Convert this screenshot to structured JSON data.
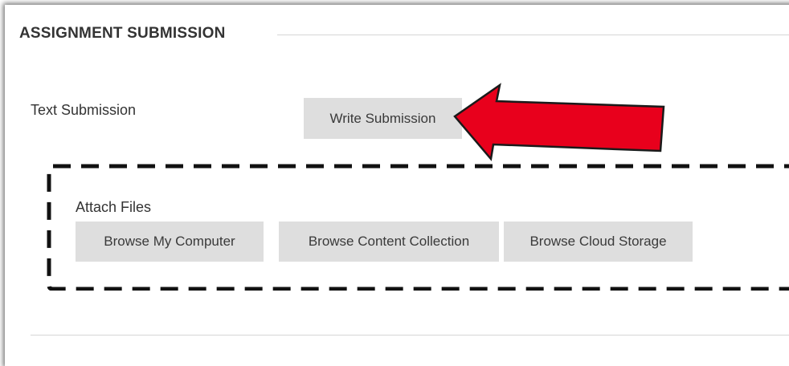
{
  "section": {
    "title": "ASSIGNMENT SUBMISSION"
  },
  "text_submission": {
    "label": "Text Submission",
    "write_button_label": "Write Submission"
  },
  "attach_files": {
    "label": "Attach Files",
    "buttons": [
      {
        "label": "Browse My Computer"
      },
      {
        "label": "Browse Content Collection"
      },
      {
        "label": "Browse Cloud Storage"
      }
    ]
  },
  "annotations": {
    "arrow_icon": "left-arrow-icon",
    "arrow_color": "#e8001c",
    "highlight_box_style": "dashed-black"
  }
}
